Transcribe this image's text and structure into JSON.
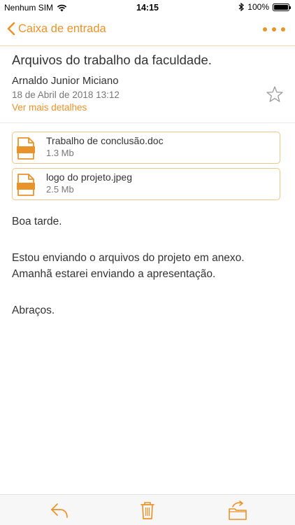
{
  "status_bar": {
    "carrier": "Nenhum SIM",
    "time": "14:15",
    "battery_percent": "100%"
  },
  "nav": {
    "back_label": "Caixa de entrada",
    "more_icon": "more-dots-icon"
  },
  "email": {
    "subject": "Arquivos do trabalho da faculdade.",
    "sender": "Arnaldo Junior Miciano",
    "date": "18 de Abril de 2018 13:12",
    "details_link": "Ver mais detalhes",
    "starred": false
  },
  "attachments": [
    {
      "name": "Trabalho de conclusão.doc",
      "size": "1.3 Mb"
    },
    {
      "name": "logo do projeto.jpeg",
      "size": "2.5 Mb"
    }
  ],
  "body": {
    "greeting": "Boa tarde.",
    "line1": "Estou enviando o arquivos do projeto em anexo.",
    "line2": "Amanhã estarei enviando a apresentação.",
    "closing": "Abraços."
  },
  "toolbar": {
    "items": [
      "reply-icon",
      "trash-icon",
      "move-folder-icon"
    ]
  },
  "colors": {
    "accent": "#e8932b",
    "attachment_border": "#ebc78b"
  }
}
